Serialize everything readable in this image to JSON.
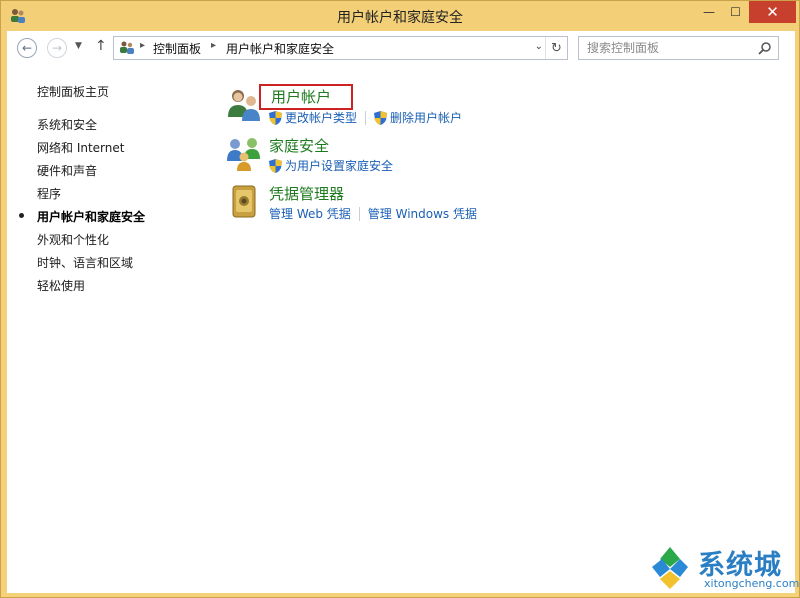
{
  "window": {
    "title": "用户帐户和家庭安全",
    "min_glyph": "—",
    "max_glyph": "☐",
    "close_glyph": "✕"
  },
  "nav": {
    "back_glyph": "←",
    "forward_glyph": "→",
    "recent_glyph": "▼",
    "up_glyph": "↑",
    "breadcrumbs": [
      "控制面板",
      "用户帐户和家庭安全"
    ],
    "crumb_sep": "▸",
    "dropdown_glyph": "⌄",
    "refresh_glyph": "↻",
    "search_placeholder": "搜索控制面板"
  },
  "sidebar": {
    "home": "控制面板主页",
    "items": [
      {
        "label": "系统和安全",
        "active": false
      },
      {
        "label": "网络和 Internet",
        "active": false
      },
      {
        "label": "硬件和声音",
        "active": false
      },
      {
        "label": "程序",
        "active": false
      },
      {
        "label": "用户帐户和家庭安全",
        "active": true
      },
      {
        "label": "外观和个性化",
        "active": false
      },
      {
        "label": "时钟、语言和区域",
        "active": false
      },
      {
        "label": "轻松使用",
        "active": false
      }
    ]
  },
  "categories": [
    {
      "title": "用户帐户",
      "icon": "users-icon",
      "links": [
        "更改帐户类型",
        "删除用户帐户"
      ]
    },
    {
      "title": "家庭安全",
      "icon": "family-safety-icon",
      "links": [
        "为用户设置家庭安全"
      ]
    },
    {
      "title": "凭据管理器",
      "icon": "credential-vault-icon",
      "links": [
        "管理 Web 凭据",
        "管理 Windows 凭据"
      ]
    }
  ],
  "watermark": {
    "title": "系统城",
    "subtitle": "xitongcheng.com"
  },
  "colors": {
    "title_bar": "#f3cf78",
    "close_button": "#c7402d",
    "category_title": "#1e7a1e",
    "link": "#1a5fb4",
    "highlight_box": "#cc2222"
  }
}
